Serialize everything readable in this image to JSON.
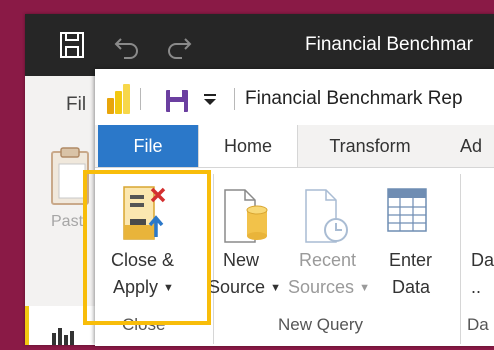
{
  "back_window": {
    "title": "Financial Benchmar",
    "file_tab": "Fil",
    "paste_label": "Past",
    "icons": [
      "save-icon",
      "undo-icon",
      "redo-icon",
      "clipboard-icon",
      "report-view-icon"
    ]
  },
  "front_window": {
    "title": "Financial Benchmark Rep",
    "qat_icons": [
      "power-bi-logo-icon",
      "save-icon",
      "customize-dropdown-icon"
    ],
    "tabs": {
      "file": "File",
      "home": "Home",
      "transform": "Transform",
      "add": "Ad"
    },
    "ribbon": {
      "close_apply": {
        "line1": "Close &",
        "line2": "Apply",
        "icon": "close-apply-icon"
      },
      "close_group": "Close",
      "new_source": {
        "line1": "New",
        "line2": "Source",
        "icon": "new-source-icon"
      },
      "recent_sources": {
        "line1": "Recent",
        "line2": "Sources",
        "icon": "recent-sources-icon"
      },
      "enter_data": {
        "line1": "Enter",
        "line2": "Data",
        "icon": "enter-data-icon"
      },
      "new_query_group": "New Query",
      "partial_button": "Da",
      "partial_group": "Da"
    }
  },
  "colors": {
    "background": "#8a1a46",
    "titlebar": "#262626",
    "file_tab": "#2b78c9",
    "highlight": "#f8bd0a",
    "power_bi_yellow": "#f2c811"
  }
}
